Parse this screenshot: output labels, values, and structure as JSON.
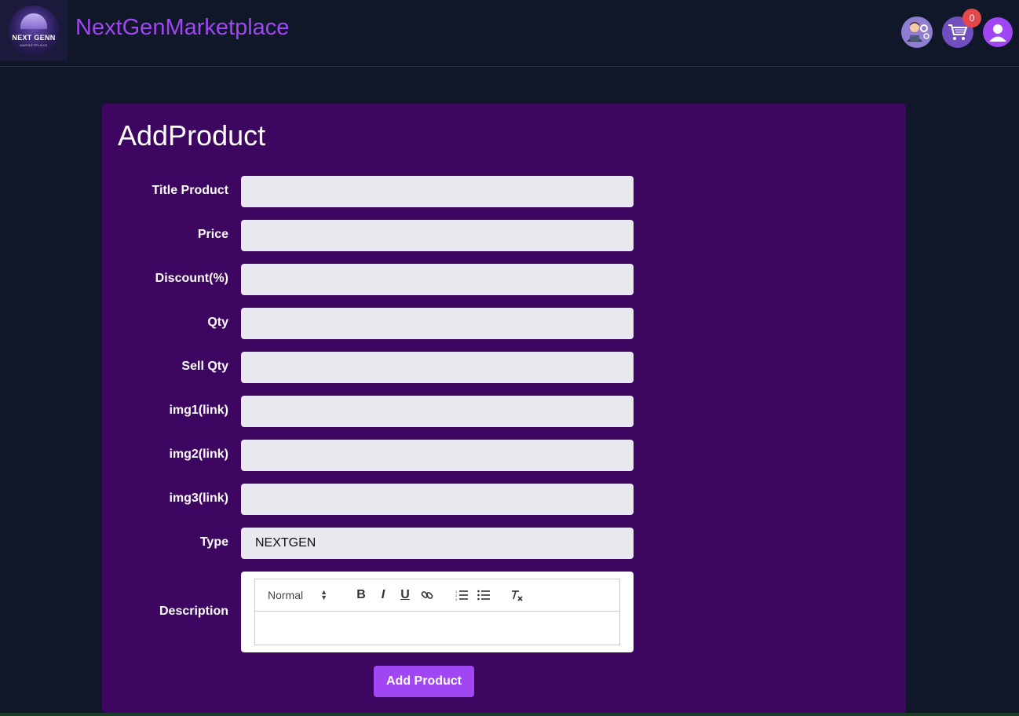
{
  "header": {
    "logo_text": "NEXT GENN",
    "logo_sub": "MARKETPLACE",
    "brand": "NextGenMarketplace",
    "cart_count": "0",
    "icons": [
      "admin-avatar-icon",
      "cart-icon",
      "user-icon"
    ]
  },
  "form": {
    "title": "AddProduct",
    "fields": [
      {
        "label": "Title Product",
        "value": ""
      },
      {
        "label": "Price",
        "value": ""
      },
      {
        "label": "Discount(%)",
        "value": ""
      },
      {
        "label": "Qty",
        "value": ""
      },
      {
        "label": "Sell Qty",
        "value": ""
      },
      {
        "label": "img1(link)",
        "value": ""
      },
      {
        "label": "img2(link)",
        "value": ""
      },
      {
        "label": "img3(link)",
        "value": ""
      },
      {
        "label": "Type",
        "value": "NEXTGEN"
      }
    ],
    "description_label": "Description",
    "editor": {
      "format_select": "Normal",
      "bold": "B",
      "italic": "I",
      "underline": "U",
      "body": ""
    },
    "submit_label": "Add Product"
  },
  "colors": {
    "background": "#0f1729",
    "card": "#3d0660",
    "accent": "#a046f2",
    "badge": "#e54848"
  }
}
